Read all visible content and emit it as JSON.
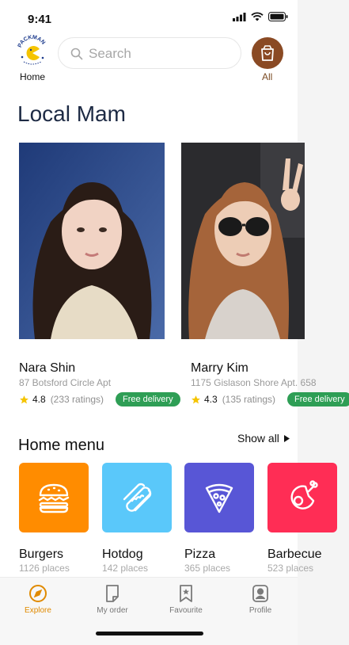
{
  "status": {
    "time": "9:41"
  },
  "header": {
    "logo_name": "PACKMAN",
    "home_label": "Home",
    "search_placeholder": "Search",
    "bag_label": "All"
  },
  "section": {
    "title": "Local Mam"
  },
  "cards": [
    {
      "name": "Nara Shin",
      "address": "87 Botsford Circle Apt",
      "rating": "4.8",
      "ratings_count": "(233 ratings)",
      "badge": "Free delivery"
    },
    {
      "name": "Marry Kim",
      "address": "1175 Gislason Shore Apt. 658",
      "rating": "4.3",
      "ratings_count": "(135 ratings)",
      "badge": "Free delivery"
    }
  ],
  "home_menu": {
    "title": "Home menu",
    "show_all": "Show all",
    "items": [
      {
        "name": "Burgers",
        "count": "1126 places",
        "color": "#ff8c00",
        "icon": "burger-icon"
      },
      {
        "name": "Hotdog",
        "count": "142 places",
        "color": "#5ac8fa",
        "icon": "hotdog-icon"
      },
      {
        "name": "Pizza",
        "count": "365 places",
        "color": "#5856d6",
        "icon": "pizza-icon"
      },
      {
        "name": "Barbecue",
        "count": "523 places",
        "color": "#ff2d55",
        "icon": "meat-icon"
      }
    ]
  },
  "tabs": [
    {
      "label": "Explore",
      "icon": "compass-icon",
      "active": true
    },
    {
      "label": "My order",
      "icon": "document-icon",
      "active": false
    },
    {
      "label": "Favourite",
      "icon": "bookmark-icon",
      "active": false
    },
    {
      "label": "Profile",
      "icon": "profile-icon",
      "active": false
    }
  ],
  "colors": {
    "accent": "#e08a00",
    "badge_green": "#2e9e55",
    "bag_brown": "#8a4a24",
    "title_navy": "#1d2a44"
  }
}
